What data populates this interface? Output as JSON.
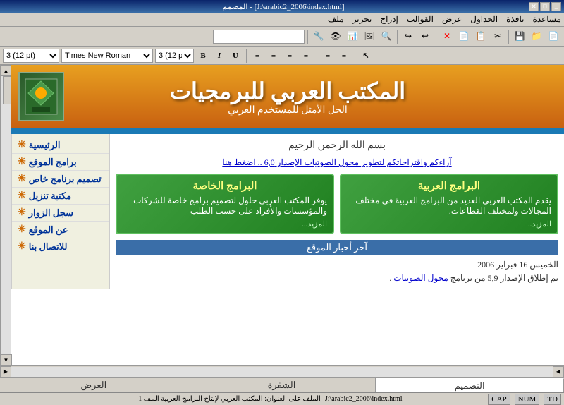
{
  "titlebar": {
    "title": "[J:\\arabic2_2006\\index.html] - المصمم",
    "buttons": [
      "_",
      "□",
      "✕"
    ]
  },
  "menubar": {
    "items": [
      "مساعدة",
      "نافذة",
      "الجداول",
      "عرض",
      "القوالب",
      "إدراج",
      "تحرير",
      "ملف"
    ]
  },
  "toolbar": {
    "buttons": [
      "📁",
      "💾",
      "✂",
      "📋",
      "📄",
      "✕",
      "↩",
      "↪",
      "🔍",
      "📷",
      "🖼",
      "📊",
      "🔧"
    ]
  },
  "format_toolbar": {
    "paragraph": "3 (12 pt)",
    "font": "Times New Roman",
    "bold": "B",
    "italic": "I",
    "underline": "U",
    "list_items": [
      "≡",
      "≡",
      "≡",
      "≡",
      "≡",
      "≡"
    ]
  },
  "nav": {
    "items": [
      "الرئيسية",
      "برامج الموقع",
      "تصميم برنامج خاص",
      "مكتبة تنزيل",
      "سجل الزوار",
      "عن الموقع",
      "للاتصال بنا"
    ]
  },
  "header": {
    "title": "المكتب العربي للبرمجيات",
    "subtitle": "الحل الأمثل للمستخدم العربي"
  },
  "content": {
    "bismillah": "بسم الله الرحمن الرحيم",
    "suggestions": "آراءكم واقتراحاتكم لتطوير محول الصوتيات الإصدار 6,0 .. اضغط هنا",
    "box1": {
      "title": "البرامج العربية",
      "body": "يقدم المكتب العربي العديد من البرامج العربية في مختلف المجالات ولمختلف القطاعات.",
      "more": "المزيد..."
    },
    "box2": {
      "title": "البرامج الخاصة",
      "body": "يوفر المكتب العربي حلول لتصميم برامج خاصة للشركات والمؤسسات والأفراد على حسب الطلب",
      "more": "المزيد..."
    },
    "news_bar": "آخر أخبار الموقع",
    "news_date": "الخميس 16 فبراير 2006",
    "news_text": "تم إطلاق الإصدار 5,9 من برنامج ",
    "news_link": "محول الصوتيات"
  },
  "bottom_tabs": {
    "tabs": [
      "التصميم",
      "الشفرة",
      "العرض"
    ]
  },
  "statusbar": {
    "td": "TD",
    "num": "NUM",
    "cap": "CAP",
    "path": "J:\\arabic2_2006\\index.html",
    "info": "الملف على  العنوان: المكتب العربي لإنتاج البرامج العربية  المف 1"
  }
}
